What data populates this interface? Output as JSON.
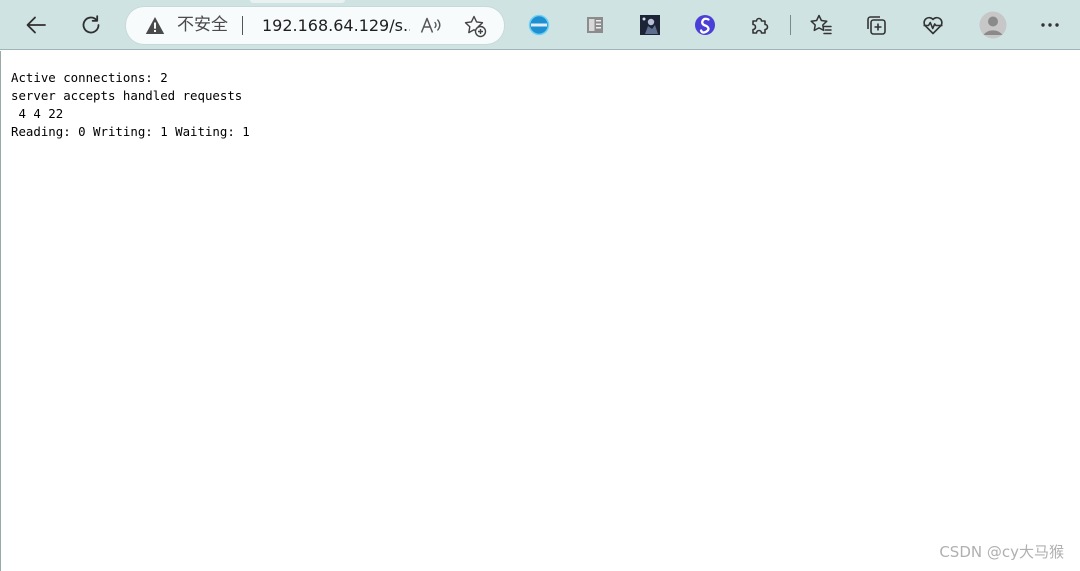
{
  "browser": {
    "security_label": "不安全",
    "url": "192.168.64.129/s...",
    "toolbar_buttons": [
      "back-icon",
      "refresh-icon"
    ],
    "address_icons": [
      "warning-icon",
      "read-aloud-icon",
      "add-favorite-icon"
    ],
    "extensions": [
      "magic-extension-icon",
      "reader-extension-icon",
      "dark-image-extension-icon",
      "purple-s-extension-icon"
    ],
    "right_actions": [
      "extensions-icon",
      "favorites-icon",
      "collections-icon",
      "health-icon",
      "profile-avatar",
      "more-menu-icon"
    ],
    "accent_color": "#cfe3e3"
  },
  "page": {
    "lines": [
      "Active connections: 2 ",
      "server accepts handled requests",
      " 4 4 22 ",
      "Reading: 0 Writing: 1 Waiting: 1 "
    ]
  },
  "watermark": {
    "text": "CSDN @cy大马猴"
  }
}
